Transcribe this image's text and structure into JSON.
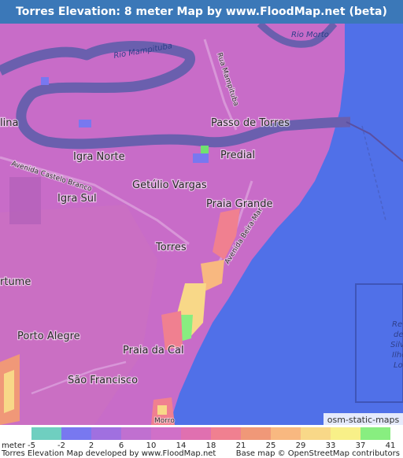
{
  "title": "Torres Elevation: 8 meter Map by www.FloodMap.net (beta)",
  "map": {
    "places": [
      {
        "name": "Passo de Torres",
        "id": "passo-de-torres"
      },
      {
        "name": "Predial",
        "id": "predial"
      },
      {
        "name": "Igra Norte",
        "id": "igra-norte"
      },
      {
        "name": "Getúlio Vargas",
        "id": "getulio-vargas"
      },
      {
        "name": "Igra Sul",
        "id": "igra-sul"
      },
      {
        "name": "Praia Grande",
        "id": "praia-grande"
      },
      {
        "name": "Torres",
        "id": "torres"
      },
      {
        "name": "Porto Alegre",
        "id": "porto-alegre"
      },
      {
        "name": "Praia da Cal",
        "id": "praia-da-cal"
      },
      {
        "name": "São Francisco",
        "id": "sao-francisco"
      },
      {
        "name": "Morro",
        "id": "morro"
      },
      {
        "name": "lina",
        "id": "lina"
      },
      {
        "name": "rtume",
        "id": "rtume"
      }
    ],
    "roads": [
      {
        "name": "Rua Mampituba",
        "id": "rua-mampituba"
      },
      {
        "name": "Avenida Castelo Branco",
        "id": "avenida-castelo-branco"
      },
      {
        "name": "Avenida Beira-Mar",
        "id": "avenida-beira-mar"
      }
    ],
    "rivers": [
      {
        "name": "Rio Mampituba",
        "id": "rio-mampituba"
      },
      {
        "name": "Rio Morto",
        "id": "rio-morto"
      }
    ],
    "sea_labels": [
      "Re",
      "de",
      "Silv",
      "Ilhe",
      "Lo"
    ],
    "attribution_badge": "osm-static-maps",
    "colors": {
      "sea": "#5070e8",
      "river": "#6a5fae",
      "low_land": "#c86cc8",
      "mid_land": "#d87ca8",
      "high_land": "#f0a070"
    }
  },
  "legend": {
    "unit": "meter",
    "ticks": [
      "-5",
      "-2",
      "2",
      "6",
      "10",
      "14",
      "18",
      "21",
      "25",
      "29",
      "33",
      "37",
      "41"
    ],
    "colors": [
      "#6fcfc0",
      "#7878f0",
      "#a070e0",
      "#c070d0",
      "#d070c8",
      "#e070b0",
      "#f08090",
      "#f09878",
      "#f8b880",
      "#f8d888",
      "#f8f088",
      "#88ee80",
      "#70e070"
    ]
  },
  "credits": {
    "left": "Torres Elevation Map developed by www.FloodMap.net",
    "right": "Base map © OpenStreetMap contributors"
  }
}
